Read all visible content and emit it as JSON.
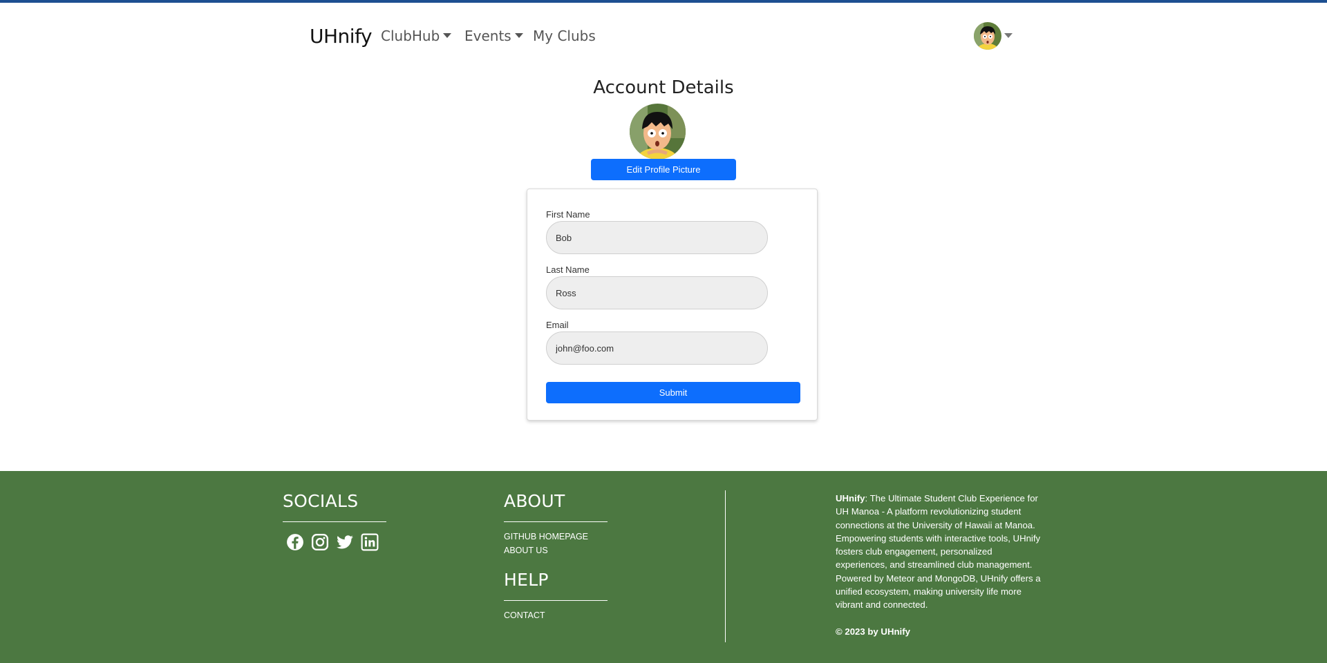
{
  "navbar": {
    "brand": "UHnify",
    "items": [
      {
        "label": "ClubHub"
      },
      {
        "label": "Events"
      },
      {
        "label": "My Clubs"
      }
    ]
  },
  "account": {
    "title": "Account Details",
    "edit_picture_label": "Edit Profile Picture",
    "fields": {
      "first_name": {
        "label": "First Name",
        "value": "Bob"
      },
      "last_name": {
        "label": "Last Name",
        "value": "Ross"
      },
      "email": {
        "label": "Email",
        "value": "john@foo.com"
      }
    },
    "submit_label": "Submit"
  },
  "footer": {
    "socials_heading": "SOCIALS",
    "socials_icons": [
      "facebook-icon",
      "instagram-icon",
      "twitter-icon",
      "linkedin-icon"
    ],
    "about_heading": "ABOUT",
    "about_links": [
      "GITHUB HOMEPAGE",
      "ABOUT US"
    ],
    "help_heading": "HELP",
    "help_links": [
      "CONTACT"
    ],
    "blurb_name": "UHnify",
    "blurb_text": ": The Ultimate Student Club Experience for UH Manoa - A platform revolutionizing student connections at the University of Hawaii at Manoa. Empowering students with interactive tools, UHnify fosters club engagement, personalized experiences, and streamlined club management. Powered by Meteor and MongoDB, UHnify offers a unified ecosystem, making university life more vibrant and connected.",
    "copyright": "© 2023 by UHnify"
  },
  "colors": {
    "accent_blue": "#0d6efd",
    "footer_green": "#4c7841",
    "top_stripe": "#1d4f91"
  }
}
